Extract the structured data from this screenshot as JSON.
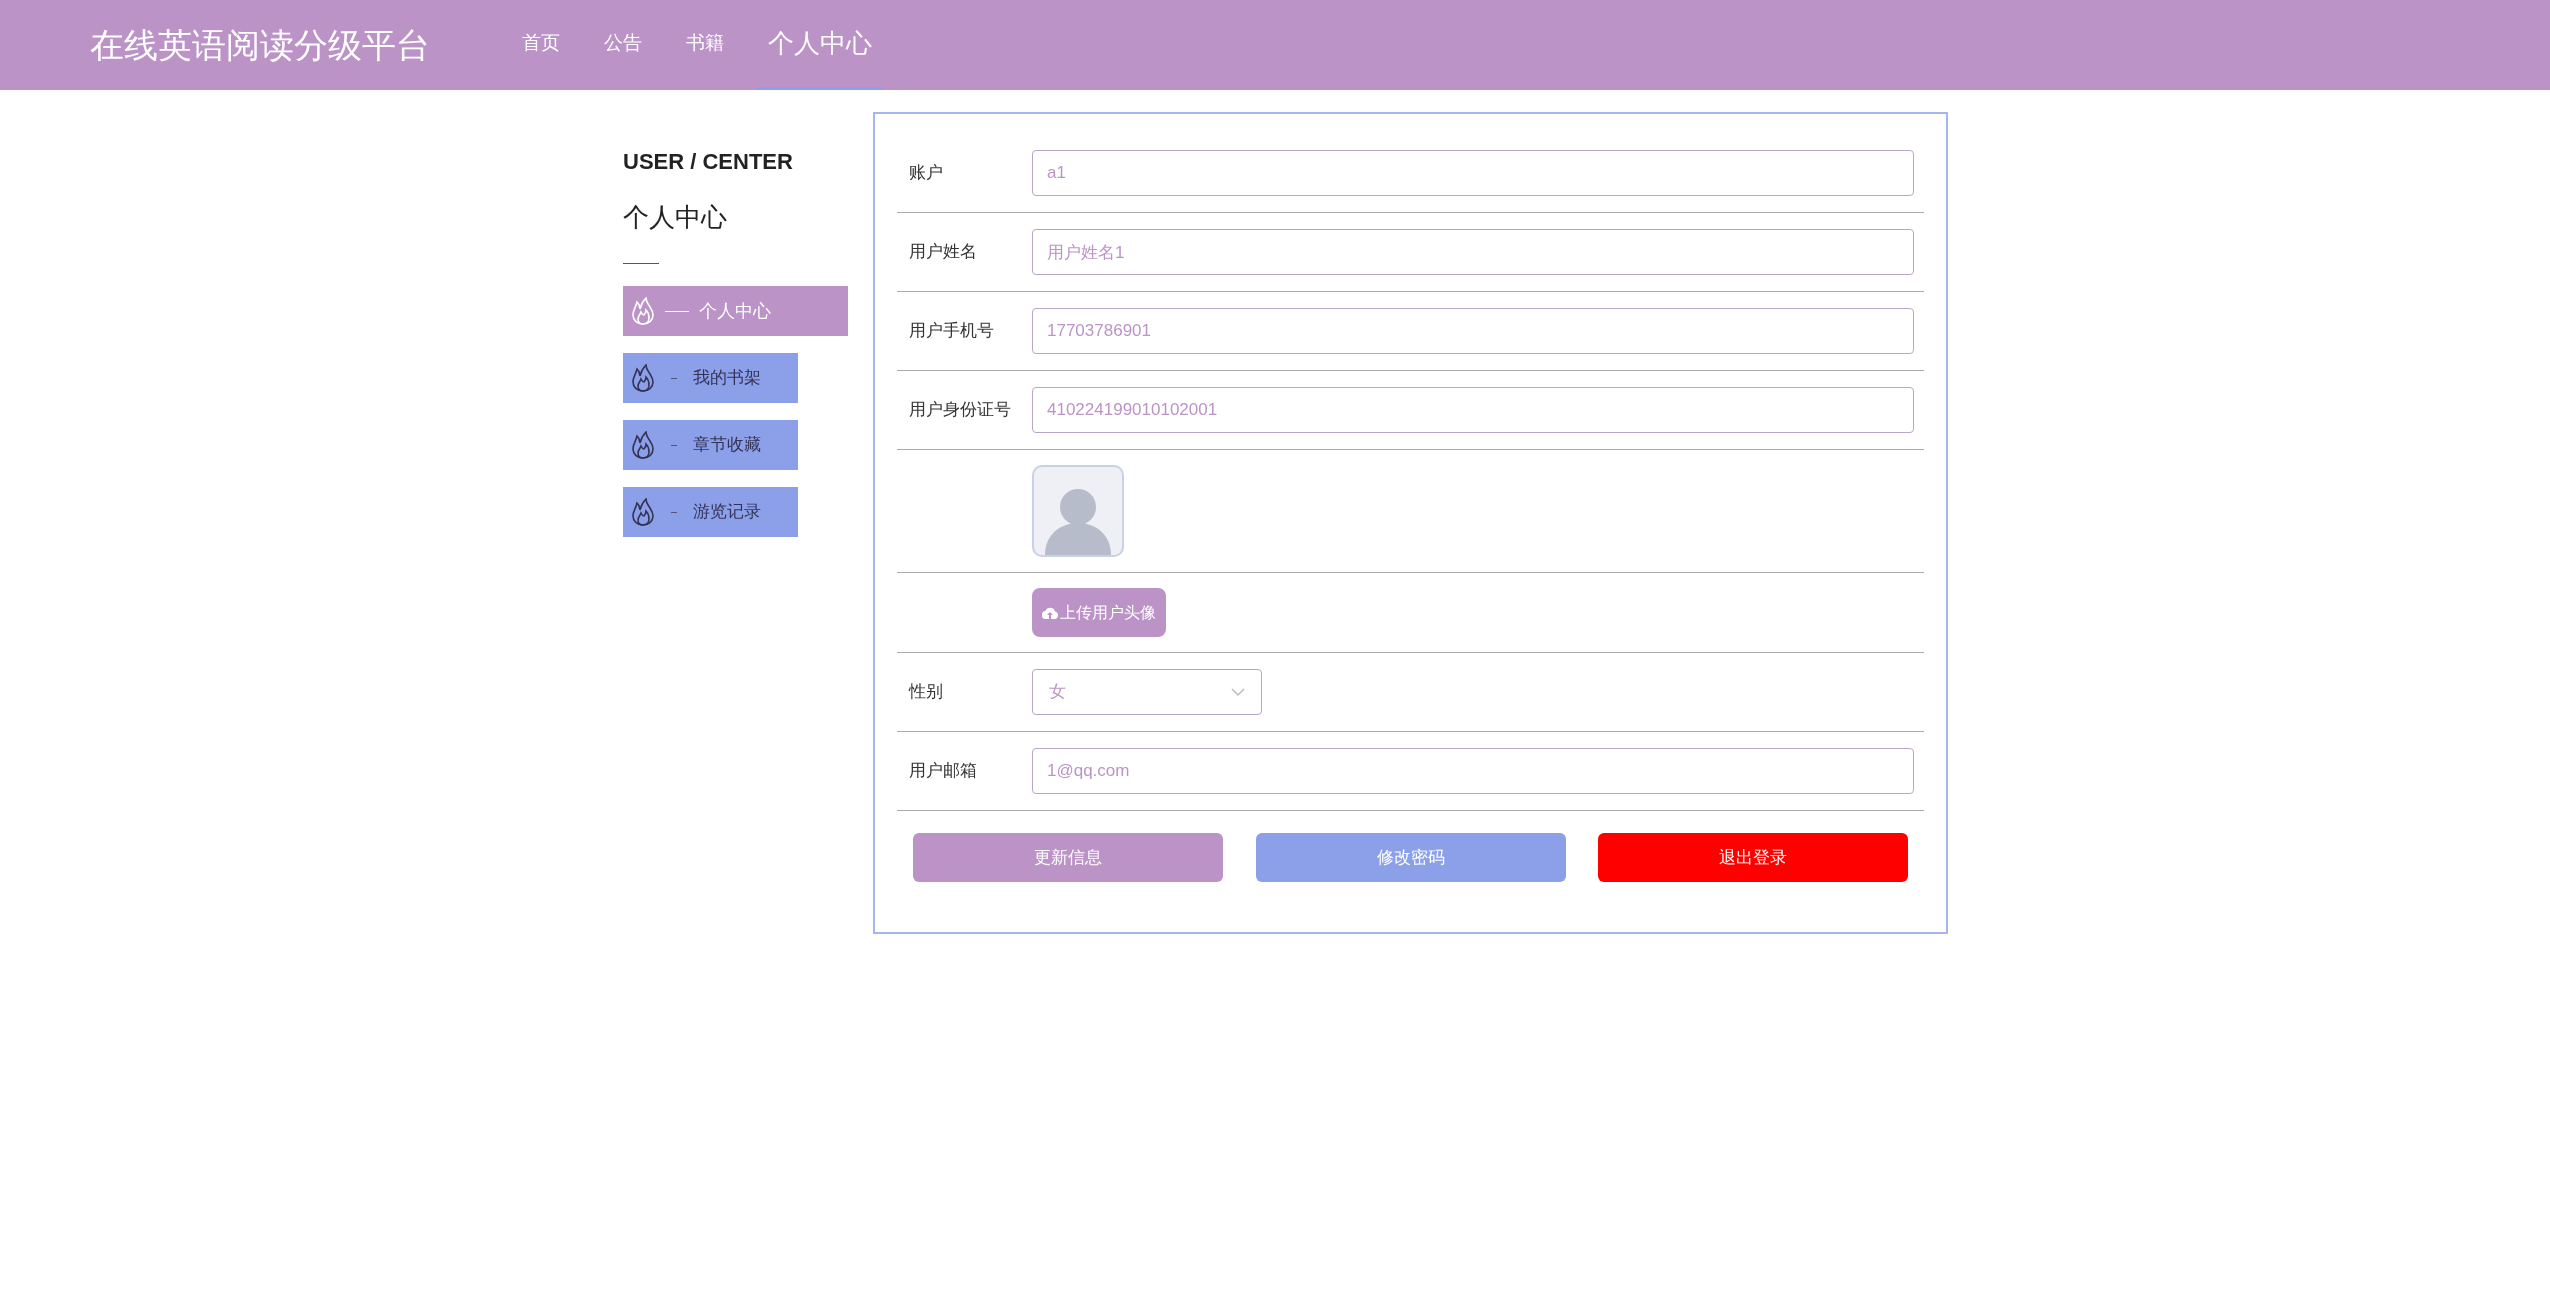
{
  "header": {
    "title": "在线英语阅读分级平台",
    "nav": [
      {
        "label": "首页",
        "selected": false
      },
      {
        "label": "公告",
        "selected": false
      },
      {
        "label": "书籍",
        "selected": false
      },
      {
        "label": "个人中心",
        "selected": true
      }
    ]
  },
  "sidebar": {
    "heading": "USER / CENTER",
    "title": "个人中心",
    "items": [
      {
        "label": "个人中心",
        "selected": true
      },
      {
        "label": "我的书架",
        "selected": false
      },
      {
        "label": "章节收藏",
        "selected": false
      },
      {
        "label": "游览记录",
        "selected": false
      }
    ]
  },
  "form": {
    "rows": [
      {
        "kind": "text",
        "label": "账户",
        "value": "a1"
      },
      {
        "kind": "text",
        "label": "用户姓名",
        "value": "用户姓名1"
      },
      {
        "kind": "text",
        "label": "用户手机号",
        "value": "17703786901"
      },
      {
        "kind": "text",
        "label": "用户身份证号",
        "value": "410224199010102001"
      },
      {
        "kind": "avatar"
      },
      {
        "kind": "upload",
        "button": "上传用户头像"
      },
      {
        "kind": "select",
        "label": "性别",
        "value": "女"
      },
      {
        "kind": "text",
        "label": "用户邮箱",
        "value": "1@qq.com"
      }
    ],
    "buttons": [
      {
        "kind": "primary",
        "label": "更新信息"
      },
      {
        "kind": "secondary",
        "label": "修改密码"
      },
      {
        "kind": "danger",
        "label": "退出登录"
      }
    ]
  }
}
